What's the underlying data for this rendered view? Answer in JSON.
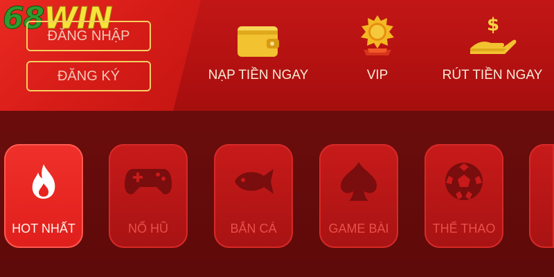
{
  "brand": {
    "logo_number": "68",
    "logo_text": "WIN"
  },
  "auth": {
    "login_label": "ĐĂNG NHẬP",
    "register_label": "ĐĂNG KÝ"
  },
  "quick_actions": [
    {
      "label": "NẠP TIỀN NGAY",
      "icon": "wallet-icon"
    },
    {
      "label": "VIP",
      "icon": "vip-badge-icon"
    },
    {
      "label": "RÚT TIỀN NGAY",
      "icon": "hand-dollar-icon"
    }
  ],
  "categories": [
    {
      "label": "HOT NHẤT",
      "icon": "flame-icon",
      "active": true
    },
    {
      "label": "NỔ HŨ",
      "icon": "gamepad-icon",
      "active": false
    },
    {
      "label": "BẮN CÁ",
      "icon": "fish-icon",
      "active": false
    },
    {
      "label": "GAME BÀI",
      "icon": "spade-icon",
      "active": false
    },
    {
      "label": "THỂ THAO",
      "icon": "soccer-ball-icon",
      "active": false
    },
    {
      "label": "",
      "icon": "",
      "active": false
    }
  ],
  "colors": {
    "accent_gold": "#f5d061",
    "header_red": "#c21616",
    "active_tile": "#f0302a",
    "inactive_tile": "#c81a1a",
    "background": "#5a0a0a"
  }
}
